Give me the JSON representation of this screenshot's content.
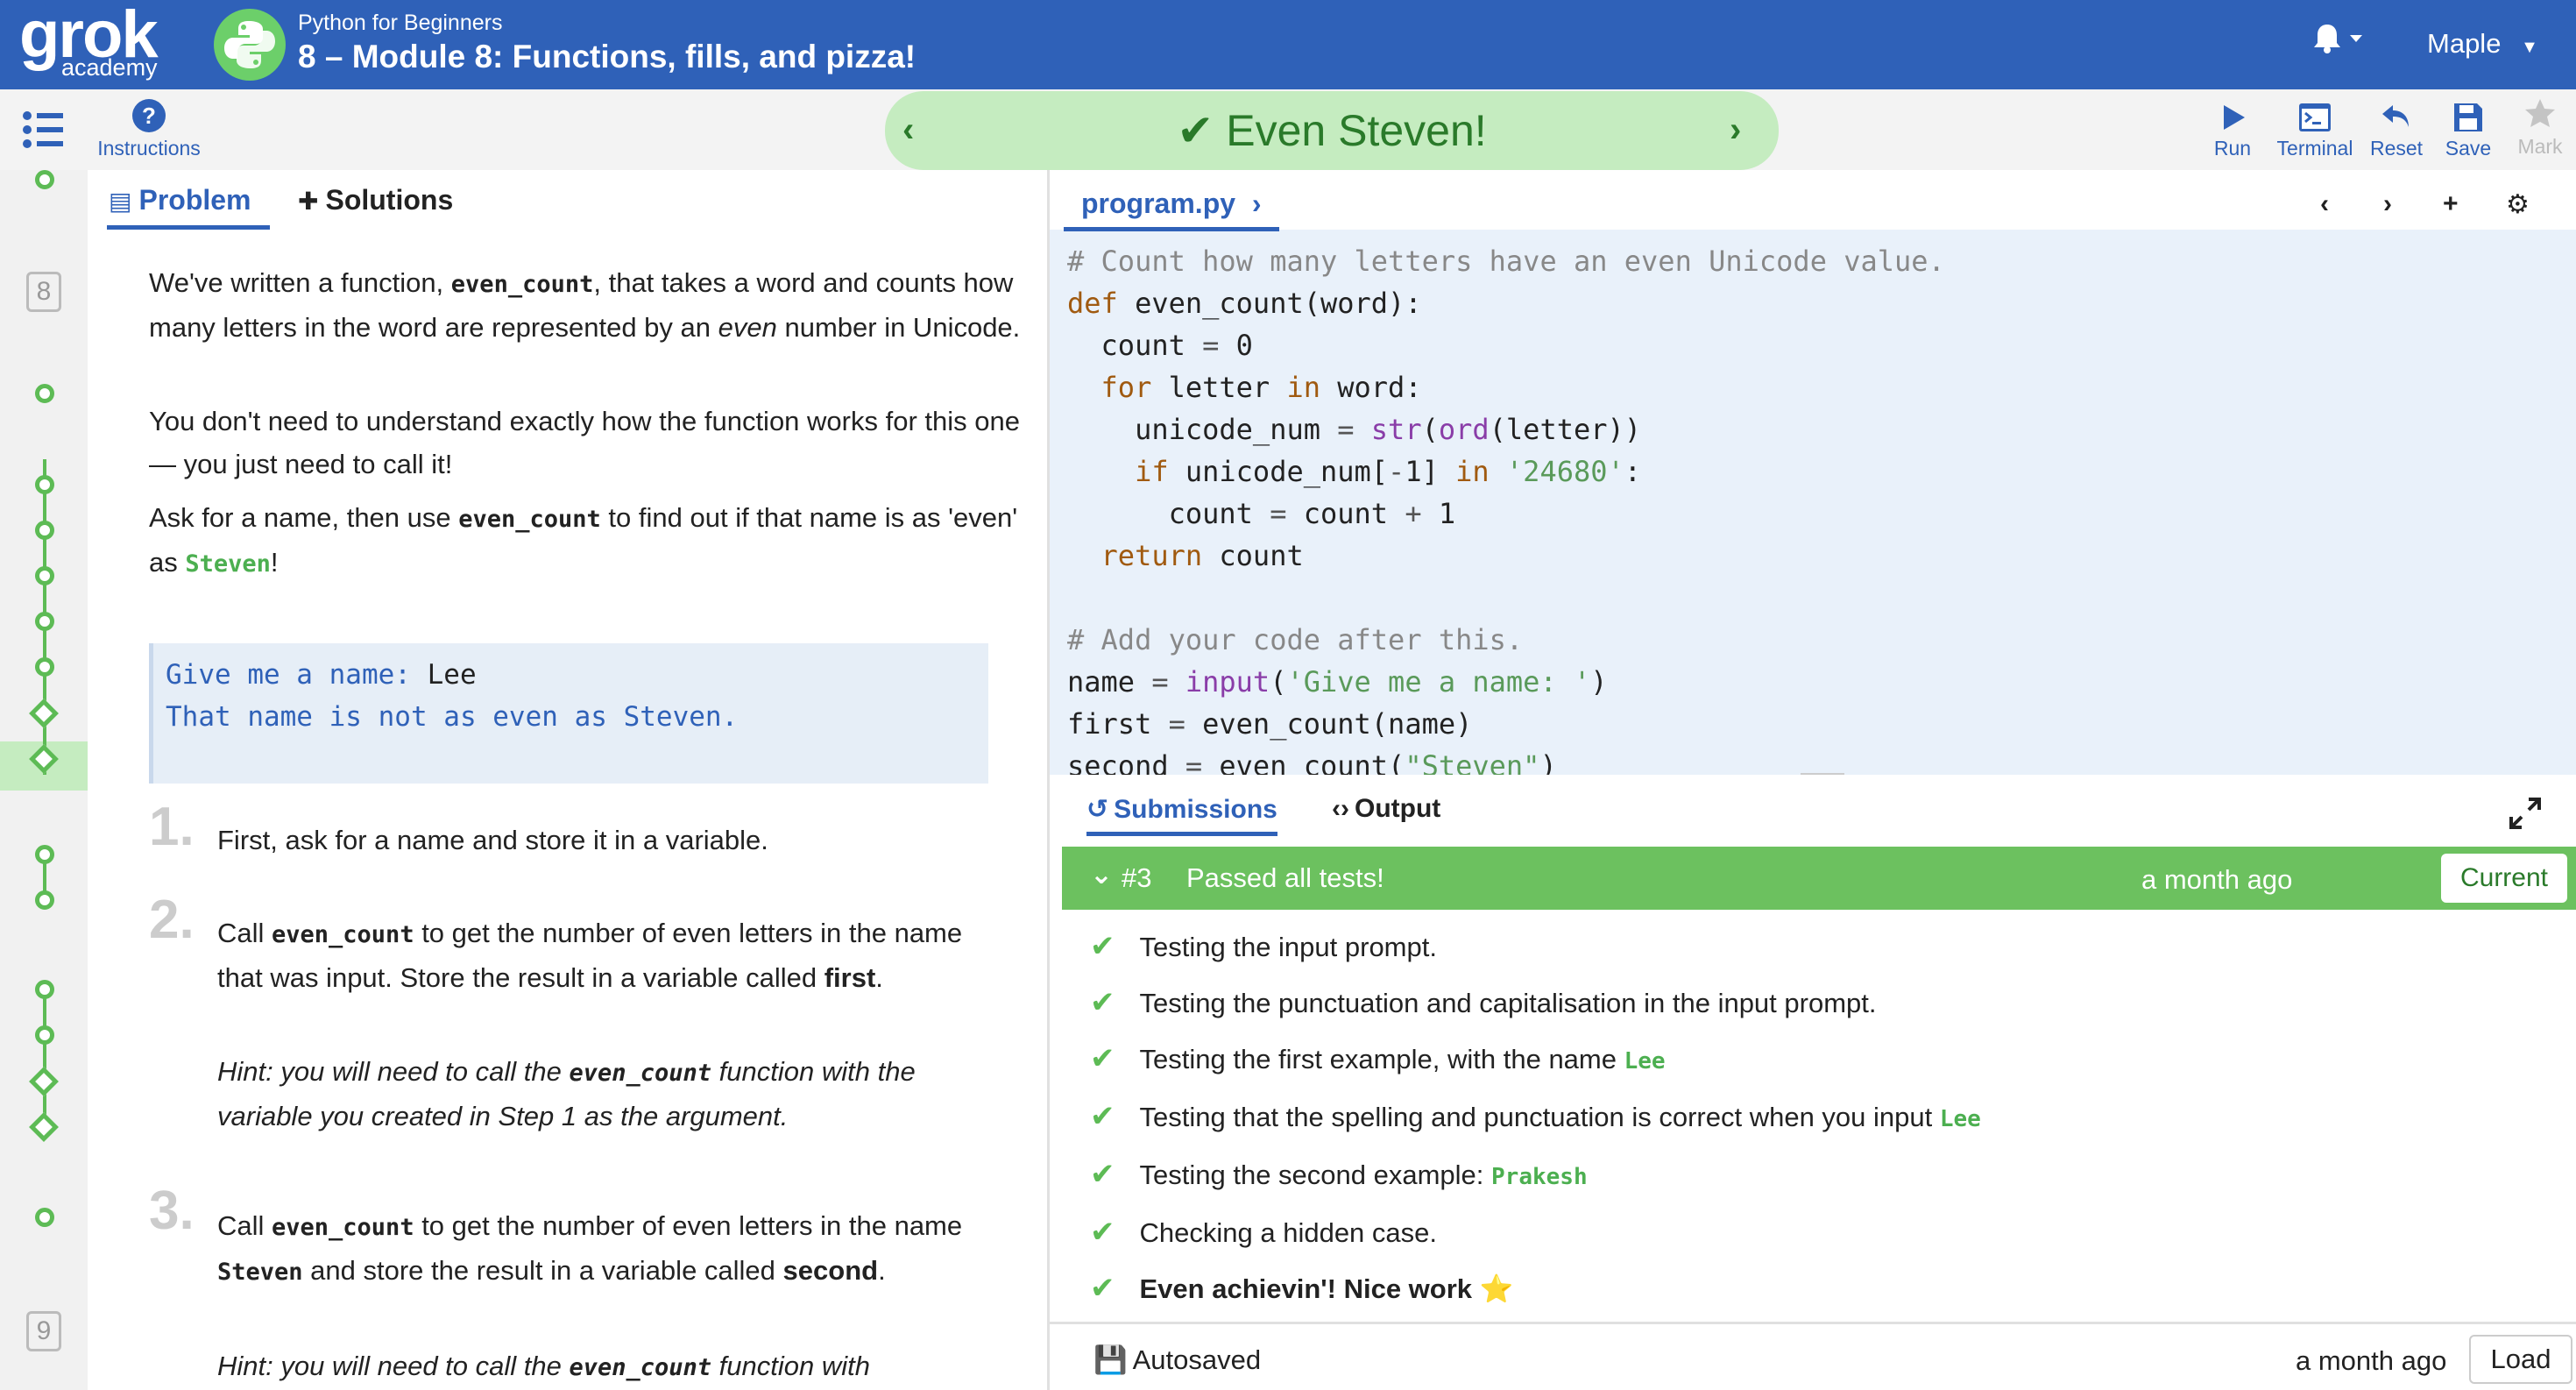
{
  "header": {
    "logo_text": "grok",
    "logo_sub": "academy",
    "course": "Python for Beginners",
    "module": "8 – Module 8: Functions, fills, and pizza!",
    "user": "Maple"
  },
  "toolbar": {
    "instructions": "Instructions",
    "banner": "Even Steven!",
    "run": "Run",
    "terminal": "Terminal",
    "reset": "Reset",
    "save": "Save",
    "mark": "Mark"
  },
  "rail": {
    "num_top": "8",
    "num_bottom": "9"
  },
  "problem": {
    "tab_problem": "Problem",
    "tab_solutions": "Solutions",
    "p1_a": "We've written a function, ",
    "p1_code": "even_count",
    "p1_b": ", that takes a word and counts how many letters in the word are represented by an ",
    "p1_em": "even",
    "p1_c": " number in Unicode.",
    "p2": "You don't need to understand exactly how the function works for this one — you just need to call it!",
    "p3_a": "Ask for a name, then use ",
    "p3_code": "even_count",
    "p3_b": " to find out if that name is as 'even' as ",
    "p3_code2": "Steven",
    "p3_c": "!",
    "example_prompt": "Give me a name: ",
    "example_input": "Lee",
    "example_output": "That name is not as even as Steven.",
    "steps": [
      {
        "num": "1.",
        "text": "First, ask for a name and store it in a variable."
      },
      {
        "num": "2.",
        "text_a": "Call ",
        "code": "even_count",
        "text_b": " to get the number of even letters in the name that was input. Store the result in a variable called ",
        "bold": "first",
        "text_c": ".",
        "hint_a": "Hint: you will need to call the ",
        "hint_code": "even_count",
        "hint_b": " function with the variable you created in Step 1 as the argument."
      },
      {
        "num": "3.",
        "text_a": "Call ",
        "code": "even_count",
        "text_b": " to get the number of even letters in the name ",
        "code2": "Steven",
        "text_c": " and store the result in a variable called ",
        "bold": "second",
        "text_d": ".",
        "hint_a": "Hint: you will need to call the ",
        "hint_code": "even_count",
        "hint_b": " function with"
      }
    ]
  },
  "editor": {
    "file": "program.py",
    "lines": [
      "# Count how many letters have an even Unicode value.",
      "def even_count(word):",
      "  count = 0",
      "  for letter in word:",
      "    unicode_num = str(ord(letter))",
      "    if unicode_num[-1] in '24680':",
      "      count = count + 1",
      "  return count",
      "",
      "# Add your code after this.",
      "name = input('Give me a name: ')",
      "first = even_count(name)",
      "second = even_count(\"Steven\")"
    ]
  },
  "submissions": {
    "tab_submissions": "Submissions",
    "tab_output": "Output",
    "number": "#3",
    "status": "Passed all tests!",
    "time": "a month ago",
    "current": "Current",
    "tests": [
      {
        "text": "Testing the input prompt.",
        "code": ""
      },
      {
        "text": "Testing the punctuation and capitalisation in the input prompt.",
        "code": ""
      },
      {
        "text": "Testing the first example, with the name ",
        "code": "Lee"
      },
      {
        "text": "Testing that the spelling and punctuation is correct when you input ",
        "code": "Lee"
      },
      {
        "text": "Testing the second example: ",
        "code": "Prakesh"
      },
      {
        "text": "Checking a hidden case.",
        "code": ""
      },
      {
        "text": "Even achievin'! Nice work",
        "code": ""
      }
    ],
    "star": "⭐",
    "autosaved": "Autosaved",
    "autosave_time": "a month ago",
    "load": "Load"
  }
}
